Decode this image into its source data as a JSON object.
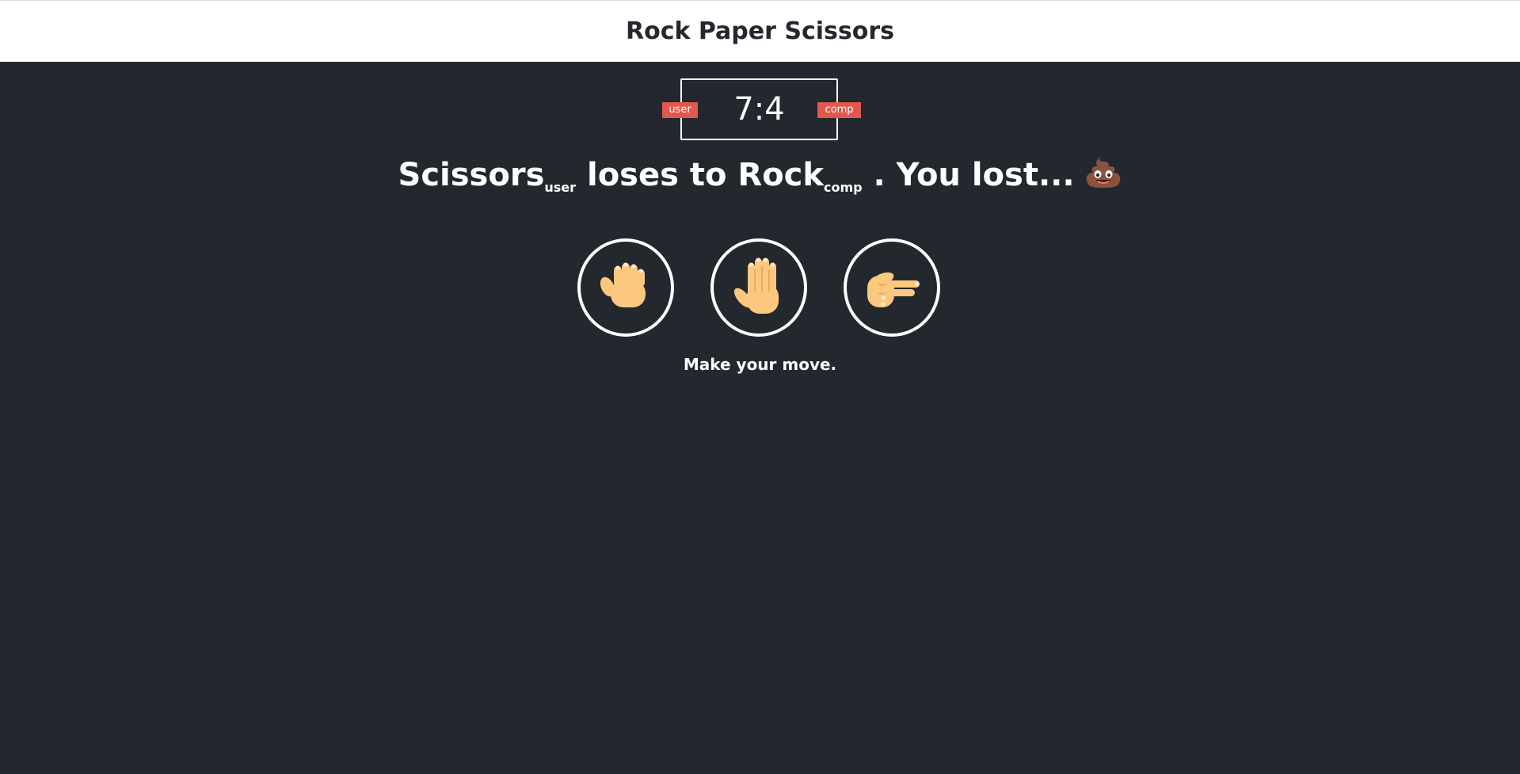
{
  "header": {
    "title": "Rock Paper Scissors"
  },
  "scoreboard": {
    "user_label": "user",
    "comp_label": "comp",
    "score": "7:4",
    "badge_color": "#e2584d"
  },
  "result": {
    "user_choice": "Scissors",
    "user_tag": "user",
    "verb": "loses to",
    "comp_choice": "Rock",
    "comp_tag": "comp",
    "outcome": ". You lost...",
    "emoji": "poop-emoji"
  },
  "choices": [
    {
      "label": "rock",
      "icon": "rock-hand-icon"
    },
    {
      "label": "paper",
      "icon": "paper-hand-icon"
    },
    {
      "label": "scissors",
      "icon": "scissors-hand-icon"
    }
  ],
  "action_message": "Make your move.",
  "colors": {
    "background": "#23272e",
    "header_bg": "#ffffff",
    "text": "#ffffff",
    "skin": "#fcc77f"
  }
}
